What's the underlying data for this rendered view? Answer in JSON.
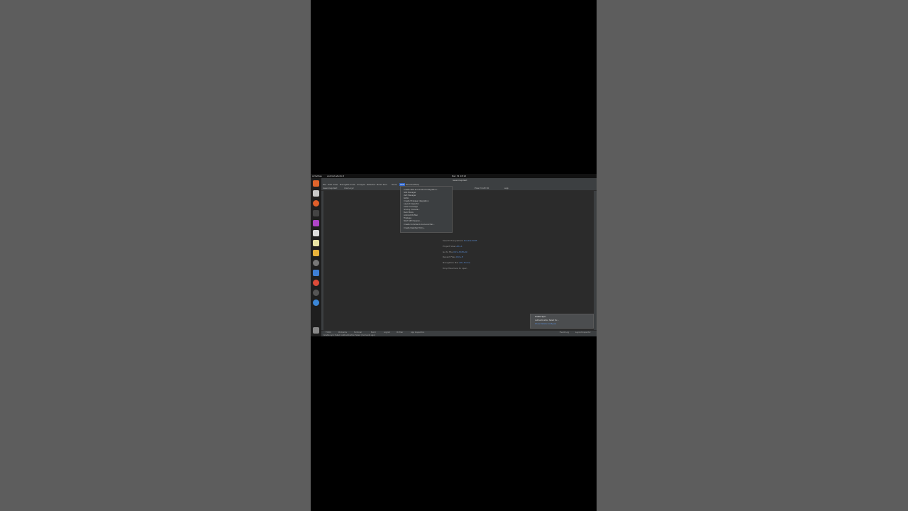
{
  "topbar": {
    "activities": "Activities",
    "app": "android-studio ▾",
    "clock": "Dec 31 18:12"
  },
  "ide": {
    "title": "lasanirapdieit"
  },
  "menu": [
    "File",
    "Edit",
    "View",
    "Navigate",
    "Code",
    "Analyze",
    "Refactor",
    "Build",
    "Run",
    "Tools",
    "VCS",
    "Window",
    "Help"
  ],
  "toolbar": {
    "project": "lasanirapdieit",
    "breadcrumb": "main.xyz",
    "device": "Pixel 3 API 30",
    "config": "app"
  },
  "tools_menu": [
    "Create SDK and Android Integration...",
    "SDK Manager",
    "AVD Manager",
    "Kotlin",
    "Create Firebase Integration",
    "Layout Inspector",
    "Code Coverage",
    "Groovy Console...",
    "Build Tools",
    "Android Profiler",
    "Firebase",
    "Start SSH Session...",
    "Create Command-line Launcher...",
    "Create Desktop Entry..."
  ],
  "welcome_hints": [
    {
      "label": "Search Everywhere",
      "key": "Double Shift"
    },
    {
      "label": "Project View",
      "key": "Alt+1"
    },
    {
      "label": "Go to File",
      "key": "Ctrl+Shift+N"
    },
    {
      "label": "Recent Files",
      "key": "Ctrl+E"
    },
    {
      "label": "Navigation Bar",
      "key": "Alt+Home"
    },
    {
      "label": "Drop files here to open",
      "key": ""
    }
  ],
  "notification": {
    "title": "Gradle Sync",
    "line1": "Authentication failed for...",
    "link": "Show Details  Configure"
  },
  "statusbar": {
    "tabs": [
      "TODO",
      "Problems",
      "Terminal",
      "Build",
      "Logcat",
      "Profiler",
      "App Inspection"
    ],
    "right": [
      "Event Log",
      "Layout Inspector"
    ],
    "message": "Gradle sync failed: Authentication failed (moments ago)"
  },
  "colors": {
    "ide_bg": "#2b2b2b",
    "panel": "#3c3f41",
    "accent": "#2f65ca",
    "link": "#5c8ed6"
  }
}
